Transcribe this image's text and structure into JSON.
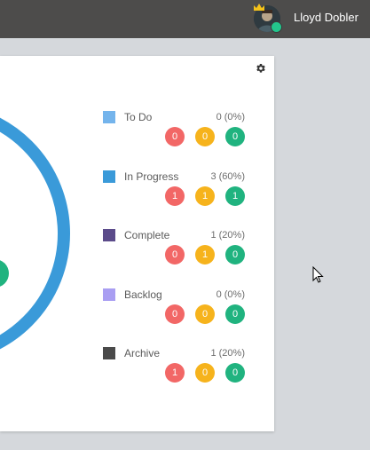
{
  "header": {
    "user_name": "Lloyd Dobler",
    "bg_color": "#4d4c4b"
  },
  "chart_data": {
    "type": "pie",
    "categories": [
      "To Do",
      "In Progress",
      "Complete",
      "Backlog",
      "Archive"
    ],
    "values": [
      0,
      3,
      1,
      0,
      1
    ]
  },
  "legend": [
    {
      "label": "To Do",
      "count": "0 (0%)",
      "color": "#74b4ec",
      "badges": [
        "0",
        "0",
        "0"
      ]
    },
    {
      "label": "In Progress",
      "count": "3 (60%)",
      "color": "#3a9ad9",
      "badges": [
        "1",
        "1",
        "1"
      ]
    },
    {
      "label": "Complete",
      "count": "1 (20%)",
      "color": "#5b4b8a",
      "badges": [
        "0",
        "1",
        "0"
      ]
    },
    {
      "label": "Backlog",
      "count": "0 (0%)",
      "color": "#a99ef2",
      "badges": [
        "0",
        "0",
        "0"
      ]
    },
    {
      "label": "Archive",
      "count": "1 (20%)",
      "color": "#4a4a4a",
      "badges": [
        "1",
        "0",
        "0"
      ]
    }
  ],
  "badge_colors": {
    "red": "#f26766",
    "yellow": "#f6b31c",
    "green": "#20b37f"
  },
  "icons": {
    "settings": "gear-icon",
    "cursor": "mouse-pointer-icon",
    "crown": "crown-icon"
  }
}
